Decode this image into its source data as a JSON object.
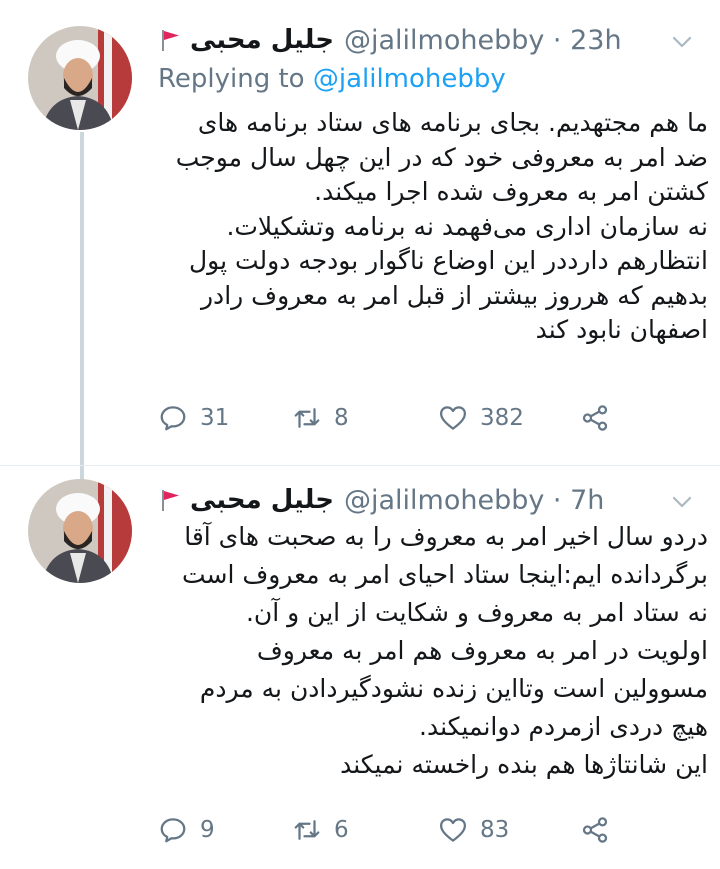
{
  "tweets": [
    {
      "display_name": "جلیل محبی",
      "handle_time": "@jalilmohebby · 23h",
      "replying_prefix": "Replying to ",
      "replying_to": "@jalilmohebby",
      "lines": [
        "ما هم مجتهدیم. بجای برنامه های ستاد برنامه های",
        "ضد امر به معروفی خود که در این چهل سال موجب",
        "کشتن امر به معروف شده اجرا میکند.",
        "نه سازمان اداری می‌فهمد نه برنامه وتشکیلات.",
        "انتظارهم دارددر این اوضاع ناگوار بودجه دولت پول",
        "بدهیم که هرروز بیشتر از قبل امر به معروف رادر",
        "اصفهان نابود کند"
      ],
      "replies": "31",
      "retweets": "8",
      "likes": "382"
    },
    {
      "display_name": "جلیل محبی",
      "handle_time": "@jalilmohebby · 7h",
      "lines": [
        "دردو سال اخیر امر به معروف را به صحبت های آقا",
        "برگردانده ایم:اینجا ستاد احیای امر به معروف است",
        "نه ستاد امر به معروف و شکایت از این و آن.",
        "اولویت در امر به معروف هم امر به معروف",
        "مسوولین است وتااین زنده نشودگیردادن به مردم",
        "هیچ دردی ازمردم دوانمیکند.",
        "این شانتاژها هم بنده راخسته نمیکند"
      ],
      "replies": "9",
      "retweets": "6",
      "likes": "83"
    }
  ],
  "icons": {
    "flag": "red-flag-icon",
    "menu": "chevron-down-icon",
    "reply": "reply-icon",
    "retweet": "retweet-icon",
    "like": "heart-icon",
    "share": "share-icon"
  },
  "colors": {
    "text": "#14171a",
    "secondary": "#657786",
    "link": "#1da1f2",
    "flag": "#e0245e",
    "thread_line": "#ccd6dd"
  }
}
